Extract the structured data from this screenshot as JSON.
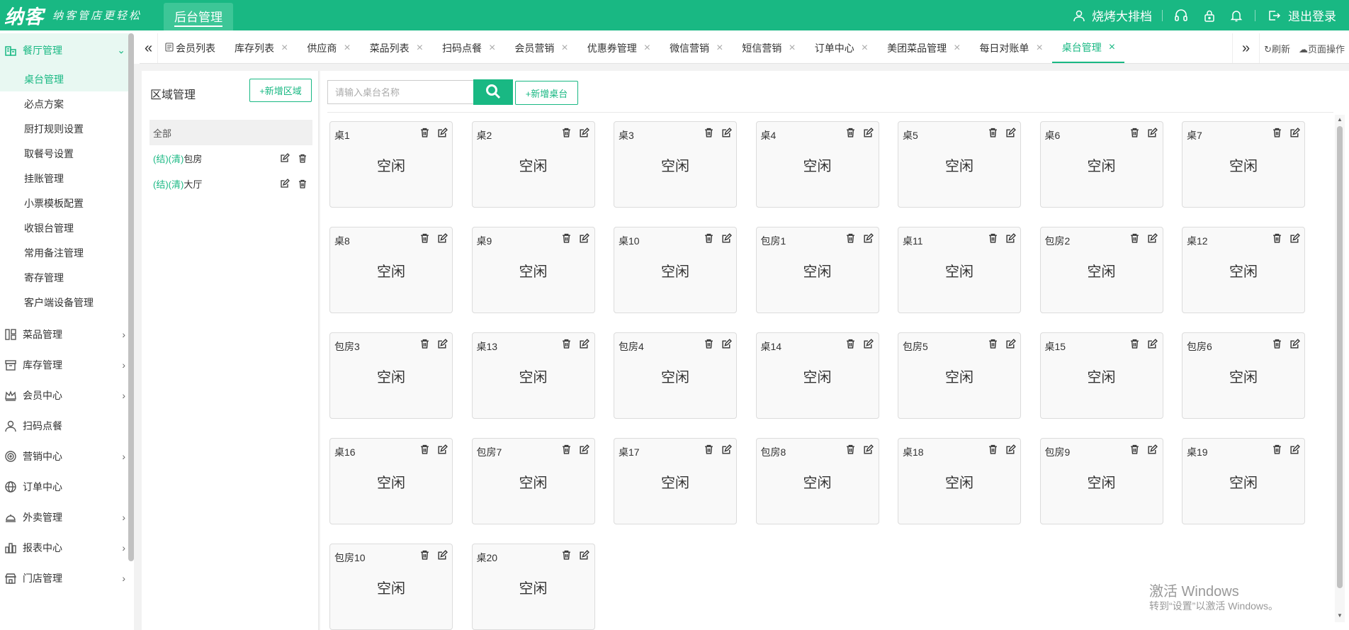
{
  "header": {
    "logo": "纳客",
    "slogan": "纳客管店更轻松",
    "nav_active": "后台管理",
    "store_name": "烧烤大排档",
    "logout": "退出登录"
  },
  "sidebar": {
    "groups": [
      {
        "label": "餐厅管理",
        "icon": "restaurant-icon",
        "open": true,
        "items": [
          "桌台管理",
          "必点方案",
          "厨打规则设置",
          "取餐号设置",
          "挂账管理",
          "小票模板配置",
          "收银台管理",
          "常用备注管理",
          "寄存管理",
          "客户端设备管理"
        ]
      },
      {
        "label": "菜品管理",
        "icon": "dishes-icon",
        "chev": true
      },
      {
        "label": "库存管理",
        "icon": "inventory-icon",
        "chev": true
      },
      {
        "label": "会员中心",
        "icon": "crown-icon",
        "chev": true
      },
      {
        "label": "扫码点餐",
        "icon": "user-icon",
        "chev": false
      },
      {
        "label": "营销中心",
        "icon": "target-icon",
        "chev": true
      },
      {
        "label": "订单中心",
        "icon": "globe-icon",
        "chev": false
      },
      {
        "label": "外卖管理",
        "icon": "delivery-icon",
        "chev": true
      },
      {
        "label": "报表中心",
        "icon": "report-icon",
        "chev": true
      },
      {
        "label": "门店管理",
        "icon": "store-icon",
        "chev": true
      }
    ],
    "active_item": "桌台管理"
  },
  "tabs": {
    "items": [
      "会员列表",
      "库存列表",
      "供应商",
      "菜品列表",
      "扫码点餐",
      "会员营销",
      "优惠券管理",
      "微信营销",
      "短信营销",
      "订单中心",
      "美团菜品管理",
      "每日对账单",
      "桌台管理"
    ],
    "active": "桌台管理",
    "refresh": "刷新",
    "page_ops": "页面操作"
  },
  "area": {
    "title": "区域管理",
    "add_button": "+新增区域",
    "items": [
      {
        "prefix": "",
        "name": "全部",
        "active": true
      },
      {
        "prefix": "(结)(清)",
        "name": "包房",
        "active": false
      },
      {
        "prefix": "(结)(清)",
        "name": "大厅",
        "active": false
      }
    ]
  },
  "search": {
    "placeholder": "请输入桌台名称",
    "add_button": "+新增桌台"
  },
  "tables": [
    {
      "name": "桌1",
      "status": "空闲"
    },
    {
      "name": "桌2",
      "status": "空闲"
    },
    {
      "name": "桌3",
      "status": "空闲"
    },
    {
      "name": "桌4",
      "status": "空闲"
    },
    {
      "name": "桌5",
      "status": "空闲"
    },
    {
      "name": "桌6",
      "status": "空闲"
    },
    {
      "name": "桌7",
      "status": "空闲"
    },
    {
      "name": "桌8",
      "status": "空闲"
    },
    {
      "name": "桌9",
      "status": "空闲"
    },
    {
      "name": "桌10",
      "status": "空闲"
    },
    {
      "name": "包房1",
      "status": "空闲"
    },
    {
      "name": "桌11",
      "status": "空闲"
    },
    {
      "name": "包房2",
      "status": "空闲"
    },
    {
      "name": "桌12",
      "status": "空闲"
    },
    {
      "name": "包房3",
      "status": "空闲"
    },
    {
      "name": "桌13",
      "status": "空闲"
    },
    {
      "name": "包房4",
      "status": "空闲"
    },
    {
      "name": "桌14",
      "status": "空闲"
    },
    {
      "name": "包房5",
      "status": "空闲"
    },
    {
      "name": "桌15",
      "status": "空闲"
    },
    {
      "name": "包房6",
      "status": "空闲"
    },
    {
      "name": "桌16",
      "status": "空闲"
    },
    {
      "name": "包房7",
      "status": "空闲"
    },
    {
      "name": "桌17",
      "status": "空闲"
    },
    {
      "name": "包房8",
      "status": "空闲"
    },
    {
      "name": "桌18",
      "status": "空闲"
    },
    {
      "name": "包房9",
      "status": "空闲"
    },
    {
      "name": "桌19",
      "status": "空闲"
    },
    {
      "name": "包房10",
      "status": "空闲"
    },
    {
      "name": "桌20",
      "status": "空闲"
    }
  ],
  "watermark": {
    "line1": "激活 Windows",
    "line2": "转到“设置”以激活 Windows。"
  },
  "colors": {
    "brand": "#19b883",
    "brand_light": "#e8f8f2"
  }
}
